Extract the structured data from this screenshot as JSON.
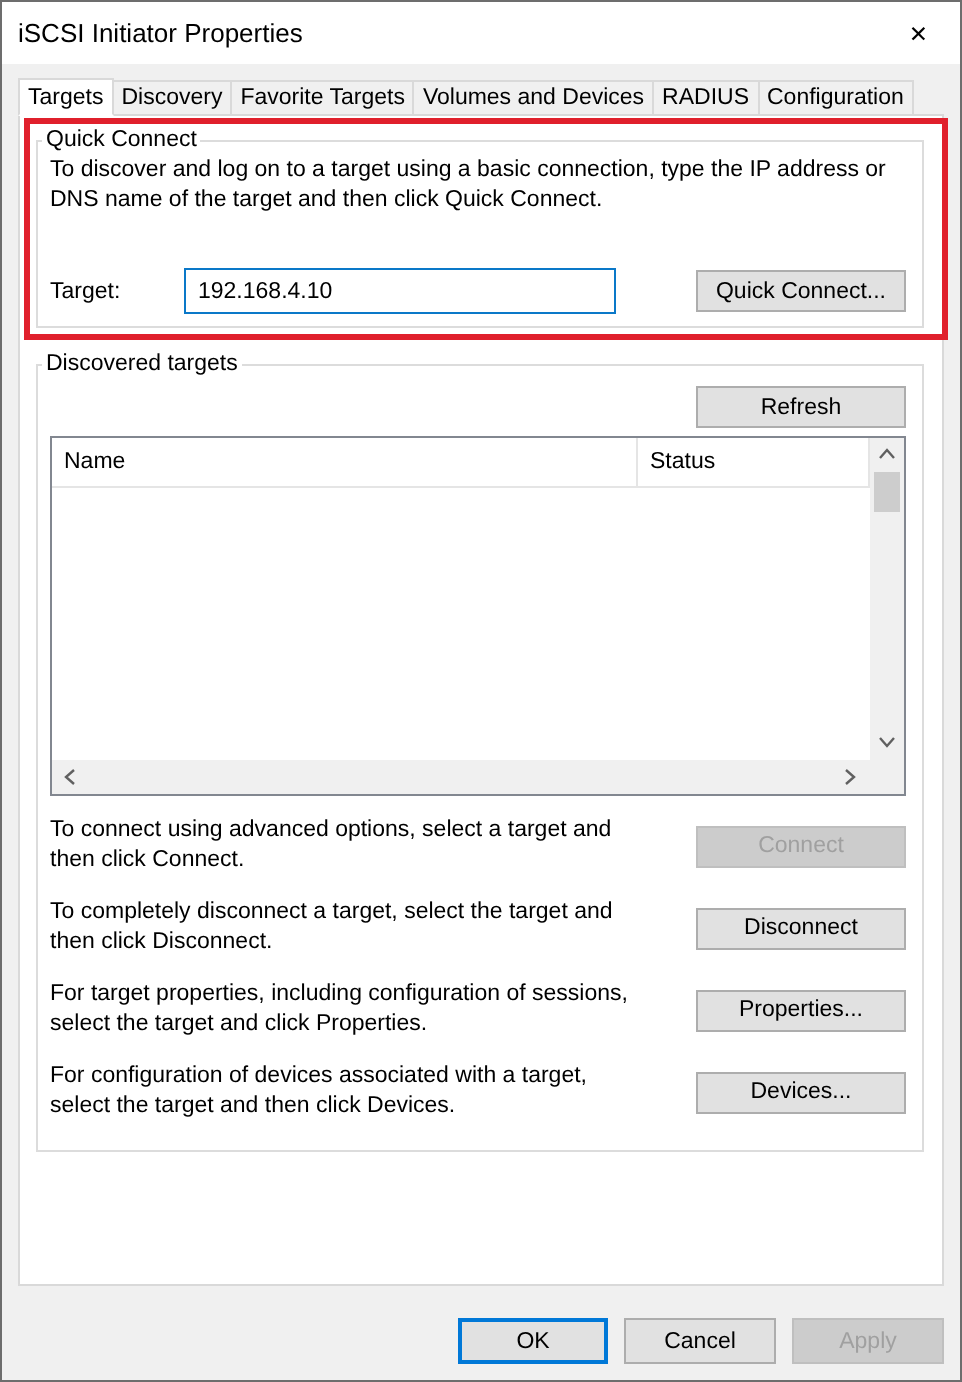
{
  "window": {
    "title": "iSCSI Initiator Properties",
    "close": "✕"
  },
  "tabs": [
    {
      "label": "Targets",
      "selected": true
    },
    {
      "label": "Discovery",
      "selected": false
    },
    {
      "label": "Favorite Targets",
      "selected": false
    },
    {
      "label": "Volumes and Devices",
      "selected": false
    },
    {
      "label": "RADIUS",
      "selected": false
    },
    {
      "label": "Configuration",
      "selected": false
    }
  ],
  "quick_connect": {
    "title": "Quick Connect",
    "highlighted": true,
    "description": "To discover and log on to a target using a basic connection, type the IP address or DNS name of the target and then click Quick Connect.",
    "target_label": "Target:",
    "target_value": "192.168.4.10",
    "button": {
      "label": "Quick Connect...",
      "disabled": false
    }
  },
  "discovered_targets": {
    "title": "Discovered targets",
    "refresh": {
      "label": "Refresh",
      "disabled": false
    },
    "columns": [
      "Name",
      "Status"
    ],
    "actions": [
      {
        "text": "To connect using advanced options, select a target and then click Connect.",
        "button": {
          "label": "Connect",
          "disabled": true
        }
      },
      {
        "text": "To completely disconnect a target, select the target and then click Disconnect.",
        "button": {
          "label": "Disconnect",
          "disabled": false
        }
      },
      {
        "text": "For target properties, including configuration of sessions, select the target and click Properties.",
        "button": {
          "label": "Properties...",
          "disabled": false
        }
      },
      {
        "text": "For configuration of devices associated with a target, select the target and then click Devices.",
        "button": {
          "label": "Devices...",
          "disabled": false
        }
      }
    ]
  },
  "footer_buttons": [
    {
      "label": "OK",
      "disabled": false,
      "default": true
    },
    {
      "label": "Cancel",
      "disabled": false,
      "default": false
    },
    {
      "label": "Apply",
      "disabled": true,
      "default": false
    }
  ]
}
